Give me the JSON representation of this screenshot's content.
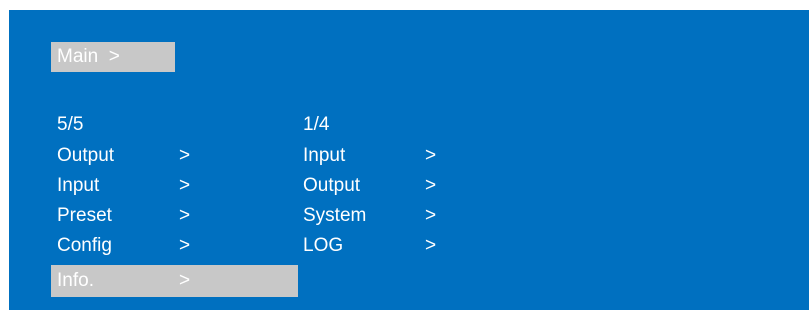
{
  "header": {
    "main_label": "Main  >"
  },
  "left_menu": {
    "page": "5/5",
    "items": [
      {
        "label": "Output",
        "arrow": ">"
      },
      {
        "label": "Input",
        "arrow": ">"
      },
      {
        "label": "Preset",
        "arrow": ">"
      },
      {
        "label": "Config",
        "arrow": ">"
      },
      {
        "label": "Info.",
        "arrow": ">"
      }
    ],
    "selected_label": "Info."
  },
  "right_menu": {
    "page": "1/4",
    "items": [
      {
        "label": "Input",
        "arrow": ">"
      },
      {
        "label": "Output",
        "arrow": ">"
      },
      {
        "label": "System",
        "arrow": ">"
      },
      {
        "label": "LOG",
        "arrow": ">"
      }
    ]
  },
  "colors": {
    "background": "#0070c0",
    "highlight": "#c8c8c8",
    "text": "#ffffff"
  }
}
